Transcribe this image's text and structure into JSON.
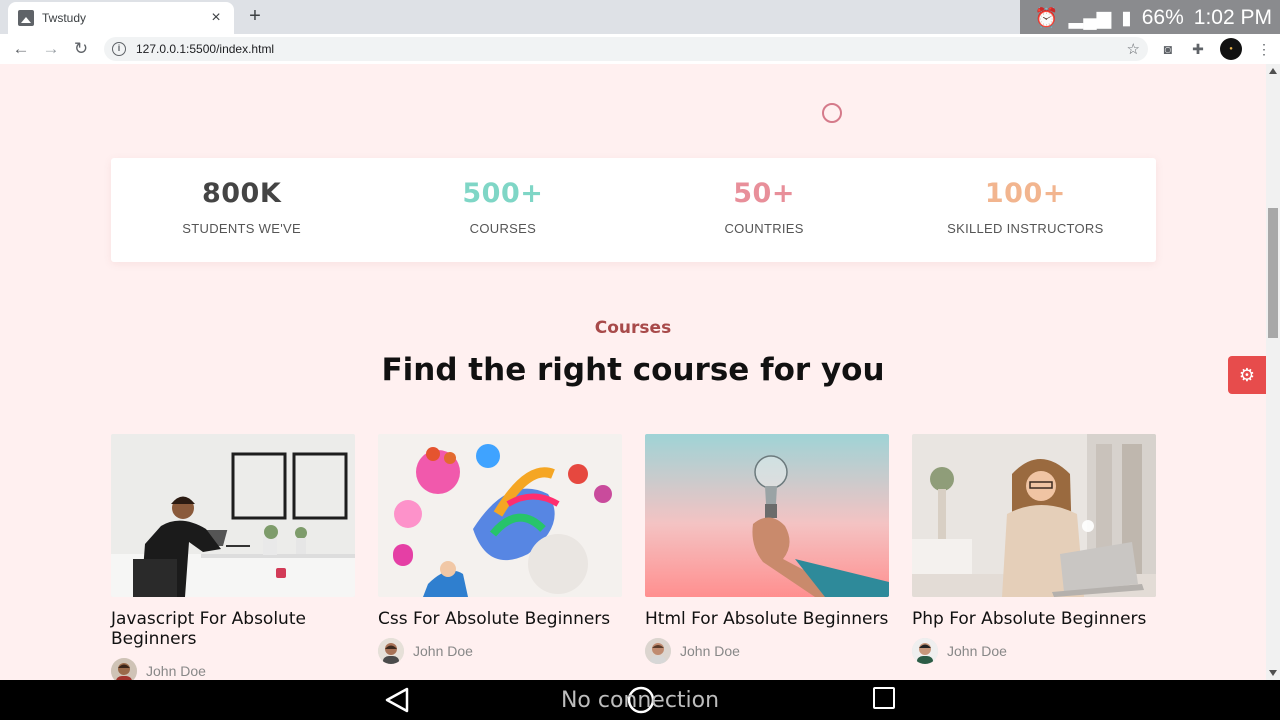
{
  "browser": {
    "tab_title": "Twstudy",
    "tab_close": "×",
    "new_tab": "+",
    "url": "127.0.0.1:5500/index.html"
  },
  "device": {
    "battery": "66%",
    "time": "1:02 PM",
    "toast": "No connection"
  },
  "stats": [
    {
      "value": "800K",
      "label": "STUDENTS WE'VE",
      "color": "#444444"
    },
    {
      "value": "500+",
      "label": "COURSES",
      "color": "#7fd6c6"
    },
    {
      "value": "50+",
      "label": "COUNTRIES",
      "color": "#e88f9a"
    },
    {
      "value": "100+",
      "label": "SKILLED INSTRUCTORS",
      "color": "#f2b58f"
    }
  ],
  "section": {
    "eyebrow": "Courses",
    "heading": "Find the right course for you"
  },
  "courses": [
    {
      "title": "Javascript For Absolute Beginners",
      "author": "John Doe"
    },
    {
      "title": "Css For Absolute Beginners",
      "author": "John Doe"
    },
    {
      "title": "Html For Absolute Beginners",
      "author": "John Doe"
    },
    {
      "title": "Php For Absolute Beginners",
      "author": "John Doe"
    }
  ],
  "colors": {
    "page_bg": "#fff0f0",
    "accent": "#e74c4c"
  },
  "icons": {
    "settings": "gear-icon",
    "back": "back-arrow-icon",
    "forward": "forward-arrow-icon",
    "reload": "reload-icon"
  }
}
